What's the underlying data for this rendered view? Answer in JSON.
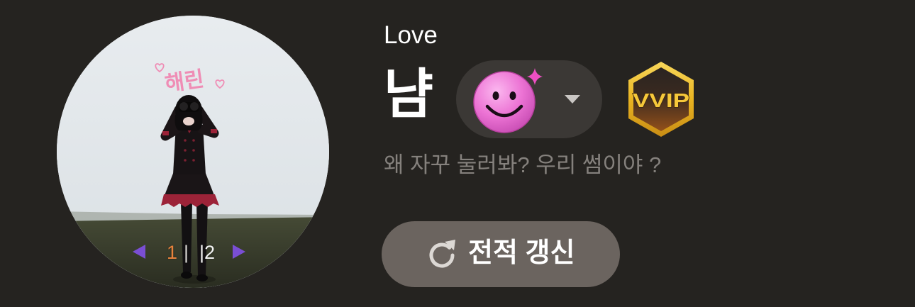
{
  "profile": {
    "tag": "Love",
    "name": "냠",
    "status_message": "왜 자꾸 눌러봐? 우리 썸이야 ?"
  },
  "avatar": {
    "caption": "해린",
    "pager": {
      "current": "1",
      "divider": "|",
      "total": "|2",
      "prev_icon": "triangle-left-icon",
      "next_icon": "triangle-right-icon"
    }
  },
  "emoji_selector": {
    "emoji_icon": "pink-smiley-face-icon",
    "sparkle_icon": "sparkle-icon",
    "dropdown_icon": "caret-down-icon"
  },
  "badge": {
    "label": "VVIP",
    "icon": "hexagon-badge-icon"
  },
  "refresh_button": {
    "label": "전적 갱신",
    "icon": "refresh-icon"
  },
  "colors": {
    "background": "#252320",
    "emoji_pill": "#3b3835",
    "refresh_button": "#6b645f",
    "status_text": "#85817d",
    "pager_current": "#e8823c",
    "pager_arrow": "#7a4ed4",
    "badge_gold": "#f6c83a",
    "emoji_pink": "#ec73d4",
    "caption_pink": "#ef8db5"
  }
}
